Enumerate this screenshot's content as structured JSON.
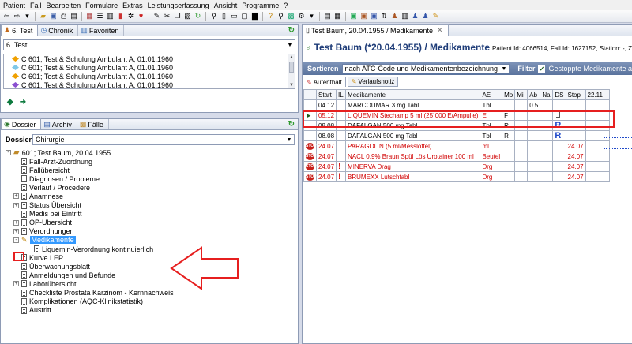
{
  "menu": [
    "Patient",
    "Fall",
    "Bearbeiten",
    "Formulare",
    "Extras",
    "Leistungserfassung",
    "Ansicht",
    "Programme",
    "?"
  ],
  "left_top": {
    "tabs": [
      {
        "label": "6. Test",
        "icon": "person-icon"
      },
      {
        "label": "Chronik",
        "icon": "clock-icon"
      },
      {
        "label": "Favoriten",
        "icon": "favorites-icon"
      }
    ],
    "combo_value": "6. Test",
    "cases": [
      {
        "text": "C 601;  Test & Schulung Ambulant A, 01.01.1960",
        "color": "#f0a000"
      },
      {
        "text": "C 601;  Test & Schulung Ambulant A, 01.01.1960",
        "color": "#7fc8e8"
      },
      {
        "text": "C 601;  Test & Schulung Ambulant A, 01.01.1960",
        "color": "#f0a000"
      },
      {
        "text": "C 601;  Test & Schulung Ambulant A, 01.01.1960",
        "color": "#8a4fd0"
      }
    ]
  },
  "left_bottom": {
    "tabs": [
      {
        "label": "Dossier",
        "icon": "search-icon"
      },
      {
        "label": "Archiv",
        "icon": "archive-icon"
      },
      {
        "label": "Fälle",
        "icon": "cases-icon"
      }
    ],
    "dossier_label": "Dossier:",
    "dossier_value": "Chirurgie",
    "tree": {
      "root": "601;  Test Baum, 20.04.1955",
      "items": [
        {
          "label": "Fall-Arzt-Zuordnung",
          "exp": ""
        },
        {
          "label": "Fallübersicht",
          "exp": ""
        },
        {
          "label": "Diagnosen / Probleme",
          "exp": ""
        },
        {
          "label": "Verlauf / Procedere",
          "exp": ""
        },
        {
          "label": "Anamnese",
          "exp": "+"
        },
        {
          "label": "Status Übersicht",
          "exp": "+"
        },
        {
          "label": "Medis bei Eintritt",
          "exp": ""
        },
        {
          "label": "OP-Übersicht",
          "exp": "+"
        },
        {
          "label": "Verordnungen",
          "exp": "+"
        },
        {
          "label": "Medikamente",
          "exp": "-",
          "selected": true
        },
        {
          "label": "Liquemin-Verordnung kontinuierlich",
          "exp": "",
          "child": true
        },
        {
          "label": "Kurve LEP",
          "exp": ""
        },
        {
          "label": "Überwachungsblatt",
          "exp": ""
        },
        {
          "label": "Anmeldungen und Befunde",
          "exp": ""
        },
        {
          "label": "Laborübersicht",
          "exp": "+"
        },
        {
          "label": "Checkliste Prostata Karzinom - Kernnachweis",
          "exp": ""
        },
        {
          "label": "Komplikationen (AQC-Klinikstatistik)",
          "exp": ""
        },
        {
          "label": "Austritt",
          "exp": ""
        }
      ]
    }
  },
  "right": {
    "tab_label": "Test Baum, 20.04.1955 / Medikamente",
    "title": "Test Baum (*20.04.1955) / Medikamente",
    "title_info": "Patient Id: 4066514, Fall Id: 1627152, Station: -, Zimm",
    "sort_label": "Sortieren",
    "sort_value": "nach ATC-Code und Medikamentenbezeichnung",
    "filter_label": "Filter",
    "filter_check": "Gestoppte Medikamente a",
    "subtabs": [
      {
        "label": "Aufenthalt",
        "icon": "pen-icon"
      },
      {
        "label": "Verlaufsnotiz",
        "icon": "note-icon"
      }
    ],
    "columns": [
      "Start",
      "IL",
      "Medikamente",
      "AE",
      "Mo",
      "Mi",
      "Ab",
      "Na",
      "DS",
      "Stop",
      "22.11"
    ],
    "rows": [
      {
        "start": "04.12",
        "name": "MARCOUMAR 3 mg Tabl",
        "ae": "Tbl",
        "ab": "0.5",
        "stop": "",
        "flag": "",
        "stopped": false
      },
      {
        "start": "05.12",
        "name": "LIQUEMIN Stechamp 5 ml (25´000 E/Ampulle)",
        "ae": "E",
        "mo": "F",
        "stop": "",
        "flag": "arrow",
        "stopped": false,
        "red": true,
        "ds": "doc"
      },
      {
        "start": "08.08",
        "name": "DAFALGAN 500 mg Tabl",
        "ae": "Tbl",
        "mo": "R",
        "ds": "R",
        "stop": "",
        "flag": "",
        "stopped": false
      },
      {
        "start": "08.08",
        "name": "DAFALGAN 500 mg Tabl",
        "ae": "Tbl",
        "mo": "R",
        "ds": "R",
        "stop": "",
        "flag": "",
        "stopped": false
      },
      {
        "start": "24.07",
        "name": "PARAGOL N (5 ml/Messlöffel)",
        "ae": "ml",
        "stop": "24.07",
        "flag": "stop",
        "stopped": true
      },
      {
        "start": "24.07",
        "name": "NACL 0.9% Braun Spül Lös Urotainer 100 ml",
        "ae": "Beutel",
        "stop": "24.07",
        "flag": "stop",
        "stopped": true
      },
      {
        "start": "24.07",
        "name": "MINERVA Drag",
        "ae": "Drg",
        "stop": "24.07",
        "flag": "stop",
        "stopped": true,
        "excl": true
      },
      {
        "start": "24.07",
        "name": "BRUMEXX Lutschtabl",
        "ae": "Drg",
        "stop": "24.07",
        "flag": "stop",
        "stopped": true,
        "excl": true
      }
    ],
    "stop_badge_text": "STOP"
  },
  "colors": {
    "accent": "#1e3c78",
    "selection": "#3399ff",
    "annotation": "#e61f1f",
    "stopped_red": "#d00000"
  }
}
